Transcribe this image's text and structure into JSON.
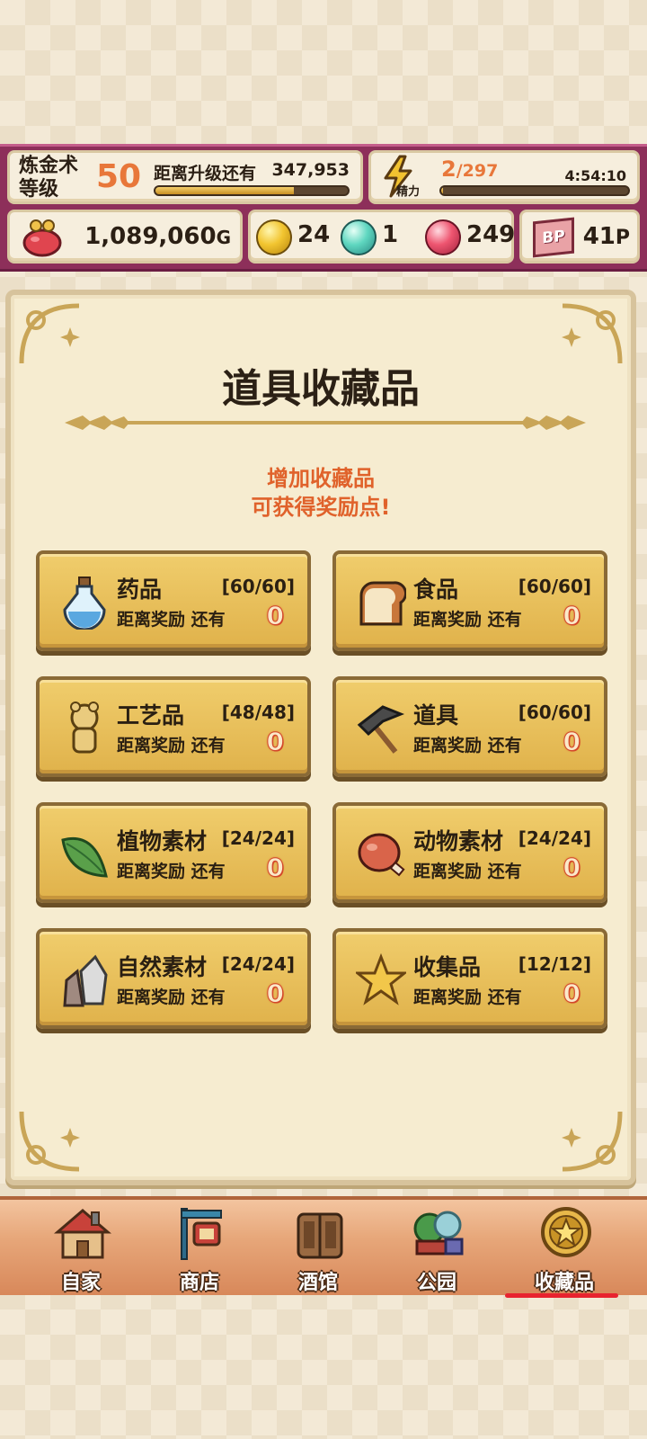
{
  "header": {
    "alchemy_label": "炼金术\n等级",
    "alchemy_level": "50",
    "upgrade_label": "距离升级还有",
    "upgrade_value": "347,953",
    "upgrade_progress": 0.72,
    "energy_icon_label": "精力",
    "energy_current": "2",
    "energy_max": "/297",
    "energy_timer": "4:54:10",
    "energy_progress": 0.01
  },
  "currency": {
    "gold": "1,089,060",
    "gold_unit": "G",
    "yellow_orb": "24",
    "cyan_orb": "1",
    "red_orb": "249",
    "bp_icon_label": "BP",
    "bp_value": "41",
    "bp_unit": "P"
  },
  "panel": {
    "title": "道具收藏品",
    "subtitle_line1": "增加收藏品",
    "subtitle_line2": "可获得奖励点!"
  },
  "categories": [
    {
      "name": "药品",
      "count": "[60/60]",
      "remaining_label": "距离奖励 还有",
      "remaining": "0",
      "icon": "potion-icon"
    },
    {
      "name": "食品",
      "count": "[60/60]",
      "remaining_label": "距离奖励 还有",
      "remaining": "0",
      "icon": "bread-icon"
    },
    {
      "name": "工艺品",
      "count": "[48/48]",
      "remaining_label": "距离奖励 还有",
      "remaining": "0",
      "icon": "figurine-icon"
    },
    {
      "name": "道具",
      "count": "[60/60]",
      "remaining_label": "距离奖励 还有",
      "remaining": "0",
      "icon": "hammer-icon"
    },
    {
      "name": "植物素材",
      "count": "[24/24]",
      "remaining_label": "距离奖励 还有",
      "remaining": "0",
      "icon": "leaf-icon"
    },
    {
      "name": "动物素材",
      "count": "[24/24]",
      "remaining_label": "距离奖励 还有",
      "remaining": "0",
      "icon": "meat-icon"
    },
    {
      "name": "自然素材",
      "count": "[24/24]",
      "remaining_label": "距离奖励 还有",
      "remaining": "0",
      "icon": "stone-icon"
    },
    {
      "name": "收集品",
      "count": "[12/12]",
      "remaining_label": "距离奖励 还有",
      "remaining": "0",
      "icon": "star-icon"
    }
  ],
  "nav": [
    {
      "label": "自家",
      "icon": "house-icon"
    },
    {
      "label": "商店",
      "icon": "shop-icon"
    },
    {
      "label": "酒馆",
      "icon": "tavern-icon"
    },
    {
      "label": "公园",
      "icon": "park-icon"
    },
    {
      "label": "收藏品",
      "icon": "collection-icon",
      "active": true
    }
  ],
  "colors": {
    "hud_bg": "#8d2f5a",
    "panel_bg": "#f6ecd0",
    "card_gold": "#e0b24b",
    "accent_orange": "#e0622b",
    "level_orange": "#e8773a"
  }
}
